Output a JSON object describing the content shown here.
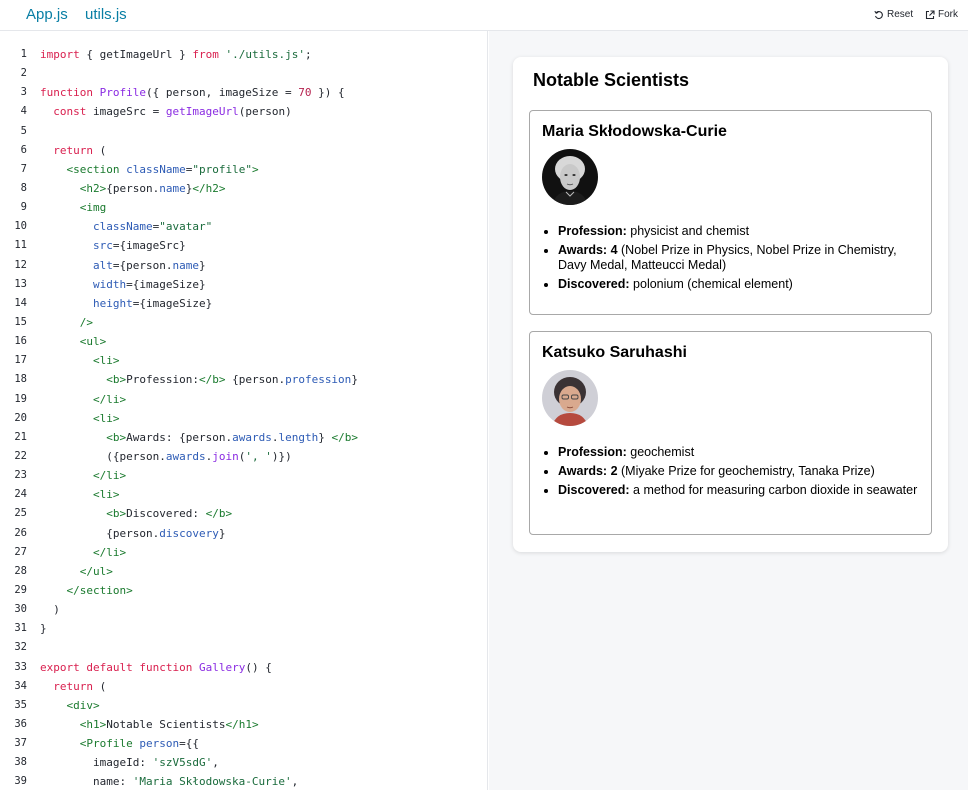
{
  "tabs": [
    "App.js",
    "utils.js"
  ],
  "actions": {
    "reset": "Reset",
    "fork": "Fork"
  },
  "code_lines": [
    "import { getImageUrl } from './utils.js';",
    "",
    "function Profile({ person, imageSize = 70 }) {",
    "  const imageSrc = getImageUrl(person)",
    "",
    "  return (",
    "    <section className=\"profile\">",
    "      <h2>{person.name}</h2>",
    "      <img",
    "        className=\"avatar\"",
    "        src={imageSrc}",
    "        alt={person.name}",
    "        width={imageSize}",
    "        height={imageSize}",
    "      />",
    "      <ul>",
    "        <li>",
    "          <b>Profession:</b> {person.profession}",
    "        </li>",
    "        <li>",
    "          <b>Awards: {person.awards.length} </b>",
    "          ({person.awards.join(', ')})",
    "        </li>",
    "        <li>",
    "          <b>Discovered: </b>",
    "          {person.discovery}",
    "        </li>",
    "      </ul>",
    "    </section>",
    "  )",
    "}",
    "",
    "export default function Gallery() {",
    "  return (",
    "    <div>",
    "      <h1>Notable Scientists</h1>",
    "      <Profile person={{",
    "        imageId: 'szV5sdG',",
    "        name: 'Maria Skłodowska-Curie',"
  ],
  "preview": {
    "heading": "Notable Scientists",
    "profiles": [
      {
        "name": "Maria Skłodowska-Curie",
        "profession_label": "Profession:",
        "profession": "physicist and chemist",
        "awards_label": "Awards: 4",
        "awards": "(Nobel Prize in Physics, Nobel Prize in Chemistry, Davy Medal, Matteucci Medal)",
        "discovered_label": "Discovered:",
        "discovered": "polonium (chemical element)"
      },
      {
        "name": "Katsuko Saruhashi",
        "profession_label": "Profession:",
        "profession": "geochemist",
        "awards_label": "Awards: 2",
        "awards": "(Miyake Prize for geochemistry, Tanaka Prize)",
        "discovered_label": "Discovered:",
        "discovered": "a method for measuring carbon dioxide in seawater"
      }
    ]
  }
}
